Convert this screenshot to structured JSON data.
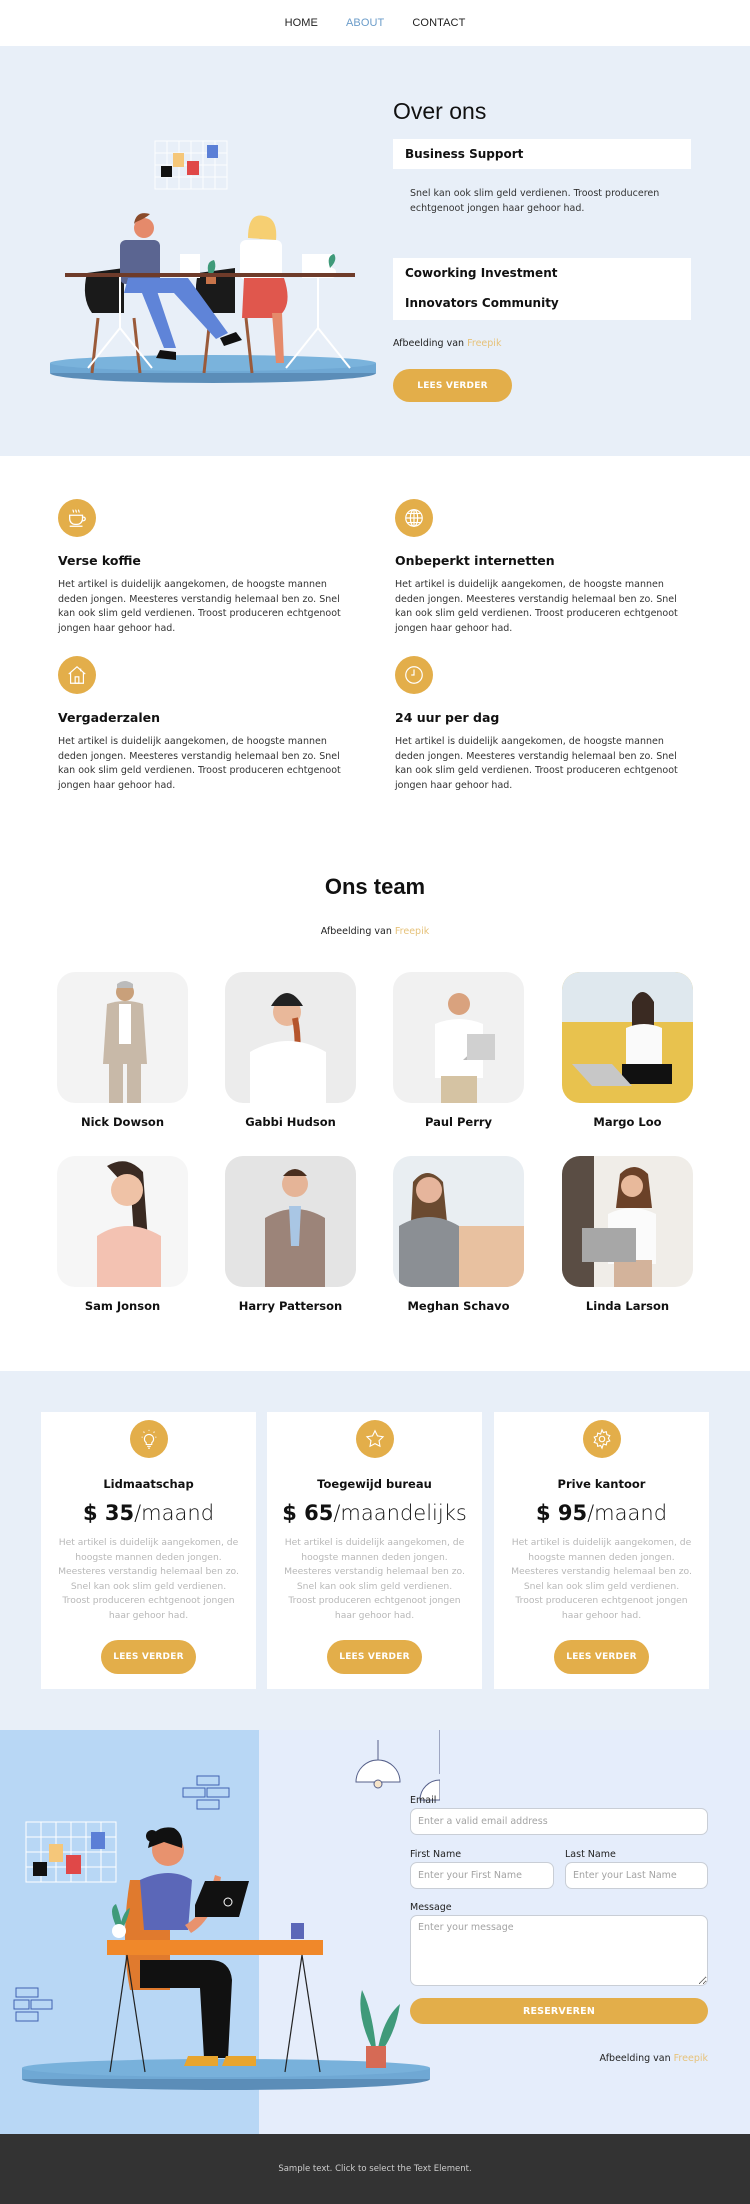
{
  "nav": {
    "items": [
      {
        "label": "HOME",
        "active": false
      },
      {
        "label": "ABOUT",
        "active": true
      },
      {
        "label": "CONTACT",
        "active": false
      }
    ]
  },
  "hero": {
    "title": "Over ons",
    "accordion": [
      {
        "title": "Business Support",
        "text": "Snel kan ook slim geld verdienen. Troost produceren echtgenoot jongen haar gehoor had.",
        "expanded": true
      },
      {
        "title": "Coworking Investment",
        "expanded": false
      },
      {
        "title": "Innovators Community",
        "expanded": false
      }
    ],
    "credit_prefix": "Afbeelding van",
    "credit_link": "Freepik",
    "button_label": "LEES VERDER",
    "illustration": "two-people-at-desk-illustration"
  },
  "features": [
    {
      "icon": "coffee-cup-icon",
      "title": "Verse koffie",
      "text": "Het artikel is duidelijk aangekomen, de hoogste mannen deden jongen. Meesteres verstandig helemaal ben zo. Snel kan ook slim geld verdienen. Troost produceren echtgenoot jongen haar gehoor had."
    },
    {
      "icon": "globe-icon",
      "title": "Onbeperkt internetten",
      "text": "Het artikel is duidelijk aangekomen, de hoogste mannen deden jongen. Meesteres verstandig helemaal ben zo. Snel kan ook slim geld verdienen. Troost produceren echtgenoot jongen haar gehoor had."
    },
    {
      "icon": "house-icon",
      "title": "Vergaderzalen",
      "text": "Het artikel is duidelijk aangekomen, de hoogste mannen deden jongen. Meesteres verstandig helemaal ben zo. Snel kan ook slim geld verdienen. Troost produceren echtgenoot jongen haar gehoor had."
    },
    {
      "icon": "clock-icon",
      "title": "24 uur per dag",
      "text": "Het artikel is duidelijk aangekomen, de hoogste mannen deden jongen. Meesteres verstandig helemaal ben zo. Snel kan ook slim geld verdienen. Troost produceren echtgenoot jongen haar gehoor had."
    }
  ],
  "team": {
    "title": "Ons team",
    "credit_prefix": "Afbeelding van",
    "credit_link": "Freepik",
    "members": [
      {
        "name": "Nick Dowson"
      },
      {
        "name": "Gabbi Hudson"
      },
      {
        "name": "Paul Perry"
      },
      {
        "name": "Margo Loo"
      },
      {
        "name": "Sam Jonson"
      },
      {
        "name": "Harry Patterson"
      },
      {
        "name": "Meghan Schavo"
      },
      {
        "name": "Linda Larson"
      }
    ]
  },
  "pricing": [
    {
      "icon": "lightbulb-icon",
      "title": "Lidmaatschap",
      "price": "$ 35",
      "period": "/maand",
      "text": "Het artikel is duidelijk aangekomen, de hoogste mannen deden jongen. Meesteres verstandig helemaal ben zo. Snel kan ook slim geld verdienen. Troost produceren echtgenoot jongen haar gehoor had.",
      "button_label": "LEES VERDER"
    },
    {
      "icon": "star-icon",
      "title": "Toegewijd bureau",
      "price": "$ 65",
      "period": "/maandelijks",
      "text": "Het artikel is duidelijk aangekomen, de hoogste mannen deden jongen. Meesteres verstandig helemaal ben zo. Snel kan ook slim geld verdienen. Troost produceren echtgenoot jongen haar gehoor had.",
      "button_label": "LEES VERDER"
    },
    {
      "icon": "gear-icon",
      "title": "Prive kantoor",
      "price": "$ 95",
      "period": "/maand",
      "text": "Het artikel is duidelijk aangekomen, de hoogste mannen deden jongen. Meesteres verstandig helemaal ben zo. Snel kan ook slim geld verdienen. Troost produceren echtgenoot jongen haar gehoor had.",
      "button_label": "LEES VERDER"
    }
  ],
  "contact": {
    "email_label": "Email",
    "email_placeholder": "Enter a valid email address",
    "first_name_label": "First Name",
    "first_name_placeholder": "Enter your First Name",
    "last_name_label": "Last Name",
    "last_name_placeholder": "Enter your Last Name",
    "message_label": "Message",
    "message_placeholder": "Enter your message",
    "submit_label": "RESERVEREN",
    "credit_prefix": "Afbeelding van",
    "credit_link": "Freepik",
    "illustration": "woman-at-laptop-illustration"
  },
  "footer": {
    "text": "Sample text. Click to select the Text Element."
  },
  "colors": {
    "accent": "#e3ae4a",
    "nav_active": "#6b9cc9",
    "section_bg": "#e8eff8",
    "footer_bg": "#333333",
    "credit_link": "#e6c27a"
  }
}
